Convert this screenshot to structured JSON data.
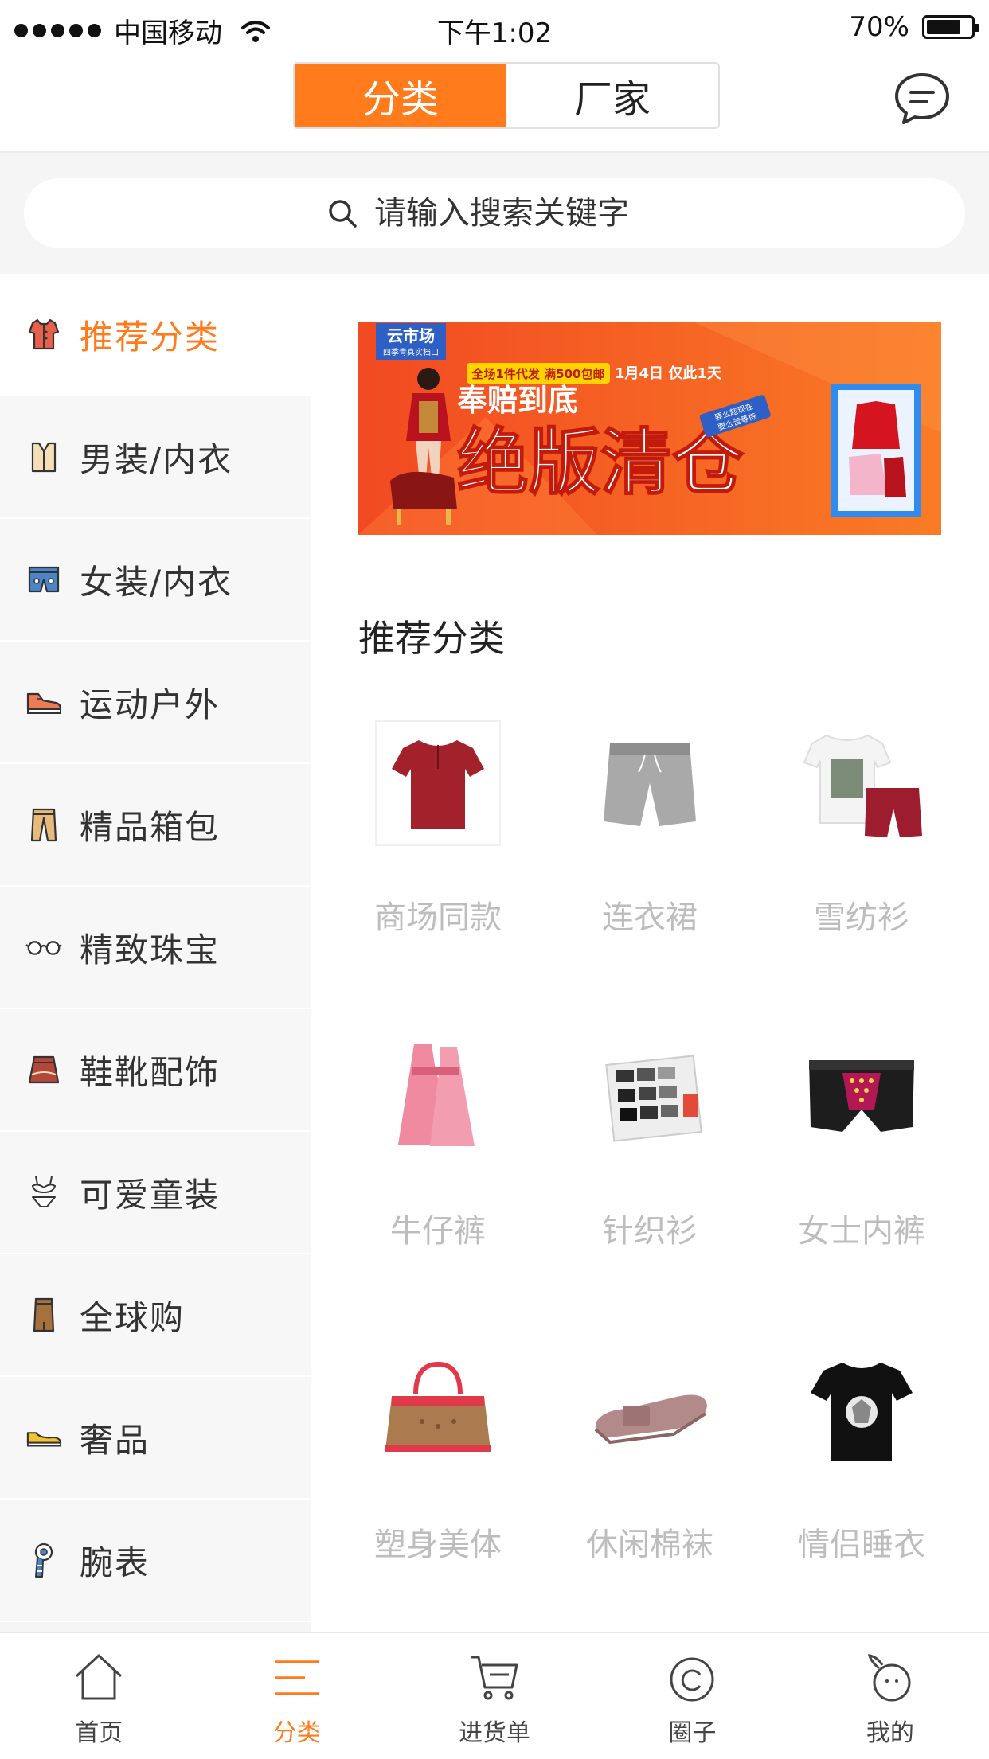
{
  "status_bar": {
    "carrier": "中国移动",
    "time": "下午1:02",
    "battery": "70%"
  },
  "header": {
    "tabs": [
      {
        "label": "分类",
        "active": true
      },
      {
        "label": "厂家",
        "active": false
      }
    ]
  },
  "search": {
    "placeholder": "请输入搜索关键字"
  },
  "sidebar": {
    "items": [
      {
        "label": "推荐分类",
        "icon": "jacket-icon",
        "active": true
      },
      {
        "label": "男装/内衣",
        "icon": "vest-icon"
      },
      {
        "label": "女装/内衣",
        "icon": "shorts-icon"
      },
      {
        "label": "运动户外",
        "icon": "sneaker-icon"
      },
      {
        "label": "精品箱包",
        "icon": "trousers-icon"
      },
      {
        "label": "精致珠宝",
        "icon": "glasses-icon"
      },
      {
        "label": "鞋靴配饰",
        "icon": "skirt-icon"
      },
      {
        "label": "可爱童装",
        "icon": "bikini-icon"
      },
      {
        "label": "全球购",
        "icon": "pencil-skirt-icon"
      },
      {
        "label": "奢品",
        "icon": "shoe-icon"
      },
      {
        "label": "腕表",
        "icon": "scarf-icon"
      }
    ]
  },
  "banner": {
    "brand": "云市场",
    "brand_sub": "四季青真实档口",
    "promo": "全场1件代发 满500包邮",
    "date": "1月4日 仅此1天",
    "headline_small": "奉赔到底",
    "headline_big": "绝版清仓",
    "tag_line1": "要么趁现在",
    "tag_line2": "要么苦等待"
  },
  "section": {
    "title": "推荐分类"
  },
  "categories": [
    {
      "label": "商场同款",
      "thumb": "red-tshirt"
    },
    {
      "label": "连衣裙",
      "thumb": "grey-shorts"
    },
    {
      "label": "雪纺衫",
      "thumb": "tshirt-shorts-set"
    },
    {
      "label": "牛仔裤",
      "thumb": "pink-dress"
    },
    {
      "label": "针织衫",
      "thumb": "socks-box"
    },
    {
      "label": "女士内裤",
      "thumb": "boxer-briefs"
    },
    {
      "label": "塑身美体",
      "thumb": "handbag"
    },
    {
      "label": "休闲棉袜",
      "thumb": "flat-shoe"
    },
    {
      "label": "情侣睡衣",
      "thumb": "black-tshirt"
    }
  ],
  "tabbar": {
    "items": [
      {
        "label": "首页",
        "icon": "home-icon"
      },
      {
        "label": "分类",
        "icon": "menu-icon",
        "active": true
      },
      {
        "label": "进货单",
        "icon": "cart-icon"
      },
      {
        "label": "圈子",
        "icon": "circle-icon"
      },
      {
        "label": "我的",
        "icon": "profile-icon"
      }
    ]
  },
  "colors": {
    "accent": "#ff7b1c",
    "muted_label": "#bdbdbd",
    "background": "#f5f5f5"
  }
}
